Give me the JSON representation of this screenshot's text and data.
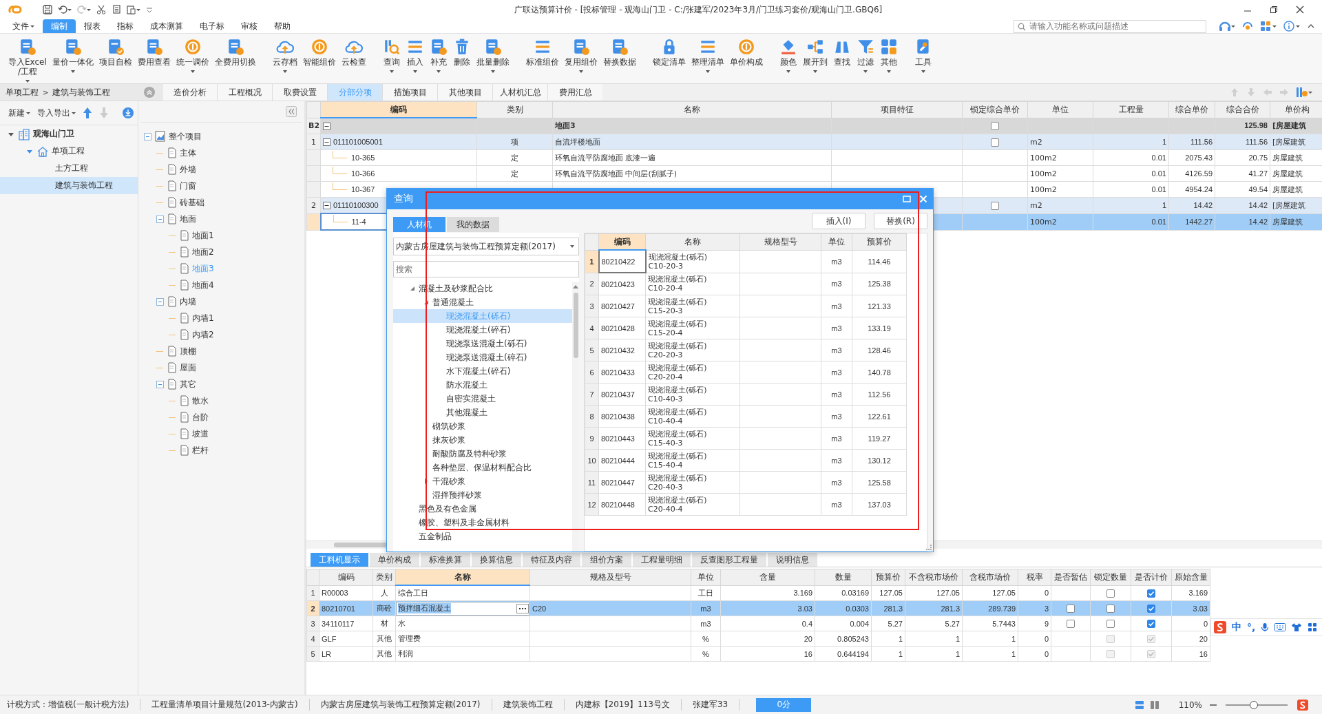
{
  "title_bar": {
    "title": "广联达预算计价 - [投标管理 - 观海山门卫 - C:/张建军/2023年3月/门卫练习套价/观海山门卫.GBQ6]"
  },
  "menu": [
    {
      "label": "文件",
      "dropdown": true,
      "selected": false
    },
    {
      "label": "编制",
      "selected": true
    },
    {
      "label": "报表",
      "selected": false
    },
    {
      "label": "指标",
      "selected": false
    },
    {
      "label": "成本测算",
      "selected": false
    },
    {
      "label": "电子标",
      "selected": false
    },
    {
      "label": "审核",
      "selected": false
    },
    {
      "label": "帮助",
      "selected": false
    }
  ],
  "search": {
    "placeholder": "请输入功能名称或问题描述"
  },
  "toolbar": [
    {
      "label": "导入Excel\n/工程",
      "dropdown": true
    },
    {
      "label": "量价一体化",
      "dropdown": true
    },
    {
      "label": "项目自检"
    },
    {
      "label": "费用查看"
    },
    {
      "label": "统一调价",
      "dropdown": true
    },
    {
      "label": "全费用切换"
    },
    {
      "label": "云存档",
      "dropdown": true
    },
    {
      "label": "智能组价"
    },
    {
      "label": "云检查"
    },
    {
      "label": "查询",
      "dropdown": true
    },
    {
      "label": "插入",
      "dropdown": true
    },
    {
      "label": "补充",
      "dropdown": true
    },
    {
      "label": "删除"
    },
    {
      "label": "批量删除",
      "dropdown": true
    },
    {
      "label": "标准组价"
    },
    {
      "label": "复用组价",
      "dropdown": true
    },
    {
      "label": "替换数据"
    },
    {
      "label": "锁定清单"
    },
    {
      "label": "整理清单",
      "dropdown": true
    },
    {
      "label": "单价构成"
    },
    {
      "label": "颜色",
      "dropdown": true
    },
    {
      "label": "展开到",
      "dropdown": true
    },
    {
      "label": "查找"
    },
    {
      "label": "过滤",
      "dropdown": true
    },
    {
      "label": "其他",
      "dropdown": true
    },
    {
      "label": "工具",
      "dropdown": true
    }
  ],
  "breadcrumb": {
    "items": [
      "单项工程",
      "建筑与装饰工程"
    ],
    "separator": ">"
  },
  "tabs": [
    {
      "label": "造价分析",
      "selected": false
    },
    {
      "label": "工程概况",
      "selected": false
    },
    {
      "label": "取费设置",
      "selected": false
    },
    {
      "label": "分部分项",
      "selected": true
    },
    {
      "label": "措施项目",
      "selected": false
    },
    {
      "label": "其他项目",
      "selected": false
    },
    {
      "label": "人材机汇总",
      "selected": false
    },
    {
      "label": "费用汇总",
      "selected": false
    }
  ],
  "project_panel": {
    "actions": [
      {
        "label": "新建",
        "dropdown": true
      },
      {
        "label": "导入导出",
        "dropdown": true
      }
    ],
    "move_up": {
      "disabled": false
    },
    "move_down": {
      "disabled": true
    },
    "tree": [
      {
        "label": "观海山门卫",
        "expanded": true,
        "selected": false,
        "children": [
          {
            "label": "单项工程",
            "expanded": true,
            "selected": false,
            "children": [
              {
                "label": "土方工程",
                "selected": false
              },
              {
                "label": "建筑与装饰工程",
                "selected": true
              }
            ]
          }
        ]
      }
    ]
  },
  "section_tree": [
    {
      "label": "整个项目",
      "expanded": true,
      "selected": false,
      "children": [
        {
          "label": "主体",
          "selected": false
        },
        {
          "label": "外墙",
          "selected": false
        },
        {
          "label": "门窗",
          "selected": false
        },
        {
          "label": "砖基础",
          "selected": false
        },
        {
          "label": "地面",
          "expanded": true,
          "selected": false,
          "children": [
            {
              "label": "地面1",
              "selected": false
            },
            {
              "label": "地面2",
              "selected": false
            },
            {
              "label": "地面3",
              "selected": true
            },
            {
              "label": "地面4",
              "selected": false
            }
          ]
        },
        {
          "label": "内墙",
          "expanded": true,
          "selected": false,
          "children": [
            {
              "label": "内墙1",
              "selected": false
            },
            {
              "label": "内墙2",
              "selected": false
            }
          ]
        },
        {
          "label": "顶棚",
          "selected": false
        },
        {
          "label": "屋面",
          "selected": false
        },
        {
          "label": "其它",
          "expanded": true,
          "selected": false,
          "children": [
            {
              "label": "散水",
              "selected": false
            },
            {
              "label": "台阶",
              "selected": false
            },
            {
              "label": "坡道",
              "selected": false
            },
            {
              "label": "栏杆",
              "selected": false
            }
          ]
        }
      ]
    }
  ],
  "main_table": {
    "columns": [
      {
        "label": "编码",
        "selected": true
      },
      {
        "label": "类别",
        "selected": false
      },
      {
        "label": "名称",
        "selected": false
      },
      {
        "label": "项目特征",
        "selected": false
      },
      {
        "label": "锁定综合单价",
        "selected": false
      },
      {
        "label": "单位",
        "selected": false
      },
      {
        "label": "工程量",
        "selected": false
      },
      {
        "label": "综合单价",
        "selected": false
      },
      {
        "label": "综合合价",
        "selected": false
      },
      {
        "label": "单价构",
        "selected": false
      }
    ],
    "rows": [
      {
        "row_header": "B2",
        "kind": "division",
        "expanded": true,
        "selected": false,
        "name": "地面3",
        "lock": {
          "checked": false
        },
        "total": "125.98",
        "price_struct": "[房屋建筑"
      },
      {
        "row_header": "1",
        "kind": "item",
        "expanded": true,
        "selected": false,
        "code": "011101005001",
        "type": "项",
        "name": "自流坪楼地面",
        "lock": {
          "checked": false
        },
        "unit": "m2",
        "qty": "1",
        "unit_price": "111.56",
        "total": "111.56",
        "price_struct": "[房屋建筑"
      },
      {
        "kind": "quota",
        "selected": false,
        "code": "10-365",
        "type": "定",
        "name": "环氧自流平防腐地面 底漆一遍",
        "unit": "100m2",
        "qty": "0.01",
        "unit_price": "2075.43",
        "total": "20.75",
        "price_struct": "房屋建筑"
      },
      {
        "kind": "quota",
        "selected": false,
        "code": "10-366",
        "type": "定",
        "name": "环氧自流平防腐地面 中间层(刮腻子)",
        "unit": "100m2",
        "qty": "0.01",
        "unit_price": "4126.59",
        "total": "41.27",
        "price_struct": "房屋建筑"
      },
      {
        "kind": "quota",
        "selected": false,
        "code": "10-367",
        "unit": "100m2",
        "qty": "0.01",
        "unit_price": "4954.24",
        "total": "49.54",
        "price_struct": "房屋建筑"
      },
      {
        "row_header": "2",
        "kind": "item",
        "expanded": true,
        "selected": false,
        "code": "01110100300",
        "lock": {
          "checked": false
        },
        "unit": "m2",
        "qty": "1",
        "unit_price": "14.42",
        "total": "14.42",
        "price_struct": "[房屋建筑"
      },
      {
        "kind": "quota",
        "selected": true,
        "code": "11-4",
        "unit": "100m2",
        "qty": "0.01",
        "unit_price": "1442.27",
        "total": "14.42",
        "price_struct": "房屋建筑"
      }
    ]
  },
  "query_dialog": {
    "title": "查询",
    "tabs": [
      {
        "label": "人材机",
        "selected": true
      },
      {
        "label": "我的数据",
        "selected": false
      }
    ],
    "buttons": [
      "插入(I)",
      "替换(R)"
    ],
    "library": "内蒙古房屋建筑与装饰工程预算定额(2017)",
    "search": {
      "placeholder": "搜索"
    },
    "tree": [
      {
        "label": "混凝土及砂浆配合比",
        "expanded": true,
        "selected": false,
        "children": [
          {
            "label": "普通混凝土",
            "expanded": true,
            "selected": false,
            "children": [
              {
                "label": "现浇混凝土(砾石)",
                "selected": true
              },
              {
                "label": "现浇混凝土(碎石)",
                "selected": false
              },
              {
                "label": "现浇泵送混凝土(砾石)",
                "selected": false
              },
              {
                "label": "现浇泵送混凝土(碎石)",
                "selected": false
              },
              {
                "label": "水下混凝土(碎石)",
                "selected": false
              },
              {
                "label": "防水混凝土",
                "selected": false
              },
              {
                "label": "自密实混凝土",
                "selected": false
              },
              {
                "label": "其他混凝土",
                "selected": false
              }
            ]
          },
          {
            "label": "砌筑砂浆",
            "selected": false
          },
          {
            "label": "抹灰砂浆",
            "selected": false
          },
          {
            "label": "耐酸防腐及特种砂浆",
            "selected": false
          },
          {
            "label": "各种垫层、保温材料配合比",
            "selected": false
          },
          {
            "label": "干混砂浆",
            "expanded": false,
            "selected": false
          },
          {
            "label": "湿拌预拌砂浆",
            "selected": false
          }
        ]
      },
      {
        "label": "黑色及有色金属",
        "selected": false
      },
      {
        "label": "橡胶、塑料及非金属材料",
        "selected": false
      },
      {
        "label": "五金制品",
        "selected": false
      }
    ],
    "columns": [
      {
        "label": "编码",
        "selected": true
      },
      {
        "label": "名称",
        "selected": false
      },
      {
        "label": "规格型号",
        "selected": false
      },
      {
        "label": "单位",
        "selected": false
      },
      {
        "label": "预算价",
        "selected": false
      }
    ],
    "rows": [
      {
        "row_header": "1",
        "selected": true,
        "code": "80210422",
        "name": "现浇混凝土(砾石)",
        "name_line_2": "C10-20-3",
        "unit": "m3",
        "price": "114.46"
      },
      {
        "row_header": "2",
        "selected": false,
        "code": "80210423",
        "name": "现浇混凝土(砾石)",
        "name_line_2": "C10-20-4",
        "unit": "m3",
        "price": "125.38"
      },
      {
        "row_header": "3",
        "selected": false,
        "code": "80210427",
        "name": "现浇混凝土(砾石)",
        "name_line_2": "C15-20-3",
        "unit": "m3",
        "price": "121.33"
      },
      {
        "row_header": "4",
        "selected": false,
        "code": "80210428",
        "name": "现浇混凝土(砾石)",
        "name_line_2": "C15-20-4",
        "unit": "m3",
        "price": "133.19"
      },
      {
        "row_header": "5",
        "selected": false,
        "code": "80210432",
        "name": "现浇混凝土(砾石)",
        "name_line_2": "C20-20-3",
        "unit": "m3",
        "price": "128.46"
      },
      {
        "row_header": "6",
        "selected": false,
        "code": "80210433",
        "name": "现浇混凝土(砾石)",
        "name_line_2": "C20-20-4",
        "unit": "m3",
        "price": "140.78"
      },
      {
        "row_header": "7",
        "selected": false,
        "code": "80210437",
        "name": "现浇混凝土(砾石)",
        "name_line_2": "C10-40-3",
        "unit": "m3",
        "price": "112.56"
      },
      {
        "row_header": "8",
        "selected": false,
        "code": "80210438",
        "name": "现浇混凝土(砾石)",
        "name_line_2": "C10-40-4",
        "unit": "m3",
        "price": "122.61"
      },
      {
        "row_header": "9",
        "selected": false,
        "code": "80210443",
        "name": "现浇混凝土(砾石)",
        "name_line_2": "C15-40-3",
        "unit": "m3",
        "price": "119.27"
      },
      {
        "row_header": "10",
        "selected": false,
        "code": "80210444",
        "name": "现浇混凝土(砾石)",
        "name_line_2": "C15-40-4",
        "unit": "m3",
        "price": "130.12"
      },
      {
        "row_header": "11",
        "selected": false,
        "code": "80210447",
        "name": "现浇混凝土(砾石)",
        "name_line_2": "C20-40-3",
        "unit": "m3",
        "price": "125.58"
      },
      {
        "row_header": "12",
        "selected": false,
        "code": "80210448",
        "name": "现浇混凝土(砾石)",
        "name_line_2": "C20-40-4",
        "unit": "m3",
        "price": "137.03"
      }
    ]
  },
  "bottom_tabs": [
    {
      "label": "工料机显示",
      "selected": true
    },
    {
      "label": "单价构成",
      "selected": false
    },
    {
      "label": "标准换算",
      "selected": false
    },
    {
      "label": "换算信息",
      "selected": false
    },
    {
      "label": "特征及内容",
      "selected": false
    },
    {
      "label": "组价方案",
      "selected": false
    },
    {
      "label": "工程量明细",
      "selected": false
    },
    {
      "label": "反查图形工程量",
      "selected": false
    },
    {
      "label": "说明信息",
      "selected": false
    }
  ],
  "detail_table": {
    "columns": [
      {
        "label": "编码",
        "selected": false
      },
      {
        "label": "类别",
        "selected": false
      },
      {
        "label": "名称",
        "selected": true
      },
      {
        "label": "规格及型号",
        "selected": false
      },
      {
        "label": "单位",
        "selected": false
      },
      {
        "label": "含量",
        "selected": false
      },
      {
        "label": "数量",
        "selected": false
      },
      {
        "label": "预算价",
        "selected": false
      },
      {
        "label": "不含税市场价",
        "selected": false
      },
      {
        "label": "含税市场价",
        "selected": false
      },
      {
        "label": "税率",
        "selected": false
      },
      {
        "label": "是否暂估",
        "selected": false
      },
      {
        "label": "锁定数量",
        "selected": false
      },
      {
        "label": "是否计价",
        "selected": false
      },
      {
        "label": "原始含量",
        "selected": false
      }
    ],
    "rows": [
      {
        "no": "1",
        "selected": false,
        "editing": false,
        "code": "R00003",
        "type": "人",
        "name": "综合工日",
        "unit": "工日",
        "content": "3.169",
        "quantity": "0.03169",
        "budget_price": "127.05",
        "market_ex_tax": "127.05",
        "market_inc_tax": "127.05",
        "tax_rate": "0",
        "lock_qty": {
          "checked": false,
          "disabled": false
        },
        "priced": {
          "checked": true,
          "disabled": false
        },
        "original_content": "3.169"
      },
      {
        "no": "2",
        "selected": true,
        "editing": true,
        "code": "80210701",
        "type": "商砼",
        "name": "预拌细石混凝土",
        "spec": "C20",
        "unit": "m3",
        "content": "3.03",
        "quantity": "0.0303",
        "budget_price": "281.3",
        "market_ex_tax": "281.3",
        "market_inc_tax": "289.739",
        "tax_rate": "3",
        "estimate": {
          "checked": false
        },
        "lock_qty": {
          "checked": false,
          "disabled": false
        },
        "priced": {
          "checked": true,
          "disabled": false
        },
        "original_content": "3.03"
      },
      {
        "no": "3",
        "selected": false,
        "editing": false,
        "code": "34110117",
        "type": "材",
        "name": "水",
        "unit": "m3",
        "content": "0.4",
        "quantity": "0.004",
        "budget_price": "5.27",
        "market_ex_tax": "5.27",
        "market_inc_tax": "5.7443",
        "tax_rate": "9",
        "estimate": {
          "checked": false
        },
        "lock_qty": {
          "checked": false,
          "disabled": false
        },
        "priced": {
          "checked": true,
          "disabled": false
        },
        "original_content": "0"
      },
      {
        "no": "4",
        "selected": false,
        "editing": false,
        "code": "GLF",
        "type": "其他",
        "name": "管理费",
        "unit": "%",
        "content": "20",
        "quantity": "0.805243",
        "budget_price": "1",
        "market_ex_tax": "1",
        "market_inc_tax": "1",
        "tax_rate": "0",
        "lock_qty": {
          "checked": false,
          "disabled": true
        },
        "priced": {
          "checked": true,
          "disabled": true
        },
        "original_content": "20"
      },
      {
        "no": "5",
        "selected": false,
        "editing": false,
        "code": "LR",
        "type": "其他",
        "name": "利润",
        "unit": "%",
        "content": "16",
        "quantity": "0.644194",
        "budget_price": "1",
        "market_ex_tax": "1",
        "market_inc_tax": "1",
        "tax_rate": "0",
        "lock_qty": {
          "checked": false,
          "disabled": true
        },
        "priced": {
          "checked": true,
          "disabled": true
        },
        "original_content": "16"
      }
    ]
  },
  "status_bar": {
    "items": [
      "计税方式：增值税(一般计税方法)",
      "工程量清单项目计量规范(2013-内蒙古)",
      "内蒙古房屋建筑与装饰工程预算定额(2017)",
      "建筑装饰工程",
      "内建标【2019】113号文",
      "张建军33"
    ],
    "score": "0分",
    "views": [
      {
        "selected": true
      },
      {
        "selected": false
      }
    ],
    "zoom": "110%",
    "zoom_slider": {
      "level": 0.45
    }
  },
  "ime_bar": {
    "mode": "中",
    "punctuation": "°,"
  }
}
